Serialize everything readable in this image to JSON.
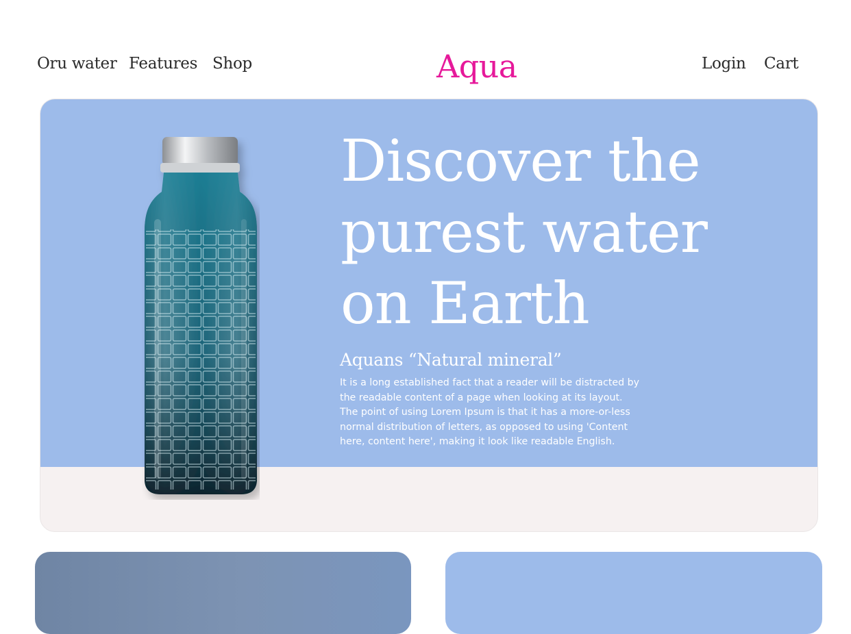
{
  "nav": {
    "left": [
      "Oru water",
      "Features",
      "Shop"
    ],
    "logo": "Aqua",
    "right": [
      "Login",
      "Cart"
    ]
  },
  "hero": {
    "headline": [
      "Discover the",
      "purest water",
      "on Earth"
    ],
    "subtitle": "Aquans “Natural mineral”",
    "body": "It is a long established fact that a reader will be distracted by the readable content of a page when looking at its layout. The point of using Lorem Ipsum is that it has a more-or-less normal distribution of letters, as opposed to using 'Content here, content here', making it look like readable English.",
    "image": "glass-water-bottle"
  },
  "colors": {
    "brand": "#e6199a",
    "hero_blue": "#9dbbea",
    "hero_base": "#f6f1f1"
  }
}
